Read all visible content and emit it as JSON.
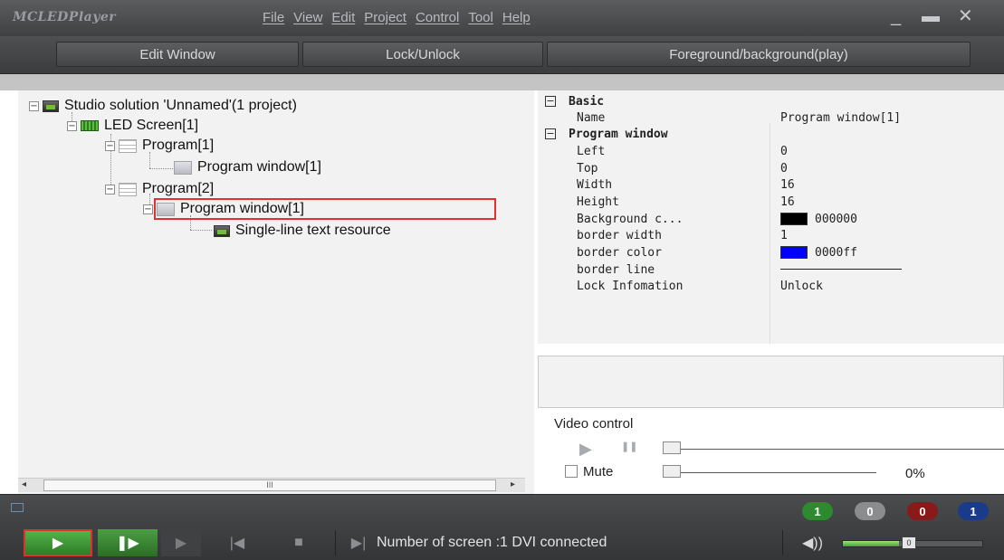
{
  "app": {
    "title": "MCLEDPlayer"
  },
  "menu": [
    "File",
    "View",
    "Edit",
    "Project",
    "Control",
    "Tool",
    "Help"
  ],
  "window_controls": {
    "minimize": "_",
    "maximize": "▬",
    "close": "✕"
  },
  "toolbar": {
    "edit_window": "Edit Window",
    "lock_unlock": "Lock/Unlock",
    "foreground_background": "Foreground/background(play)"
  },
  "tree": {
    "root": "Studio solution 'Unnamed'(1 project)",
    "screen": "LED Screen[1]",
    "program1": "Program[1]",
    "program1_window": "Program window[1]",
    "program2": "Program[2]",
    "program2_window": "Program window[1]",
    "resource": "Single-line text resource",
    "expander_minus": "−"
  },
  "scrollbar": {
    "left_arrow": "◂",
    "thumb_grip": "III",
    "right_arrow": "▸"
  },
  "properties": {
    "basic_category": "Basic",
    "name_label": "Name",
    "name_value": "Program window[1]",
    "window_category": "Program window",
    "left_label": "Left",
    "left_value": "0",
    "top_label": "Top",
    "top_value": "0",
    "width_label": "Width",
    "width_value": "16",
    "height_label": "Height",
    "height_value": "16",
    "bg_label": "Background c...",
    "bg_value": "000000",
    "bg_color": "#000000",
    "border_width_label": "border width",
    "border_width_value": "1",
    "border_color_label": "border color",
    "border_color_value": "0000ff",
    "border_color_hex": "#0000ff",
    "border_line_label": "border line",
    "lock_label": "Lock Infomation",
    "lock_value": "Unlock",
    "expander_minus": "−"
  },
  "video": {
    "label": "Video control",
    "play_icon": "▶",
    "pause_icon": "❚❚",
    "mute_label": "Mute",
    "percent": "0%",
    "progress_fraction": 0
  },
  "status_indicators": [
    {
      "value": "1",
      "color": "#2e8a2e"
    },
    {
      "value": "0",
      "color": "#8a8c8e"
    },
    {
      "value": "0",
      "color": "#8a1a1a"
    },
    {
      "value": "1",
      "color": "#1a3a8a"
    }
  ],
  "controls": {
    "play": "▶",
    "step": "❚▶",
    "next": "▶",
    "first": "|◀",
    "stop": "■",
    "step_next": "▶|",
    "status_text": "Number of screen :1 DVI connected",
    "volume_icon": "◀))",
    "volume_value": "0",
    "volume_fraction": 0.4
  }
}
